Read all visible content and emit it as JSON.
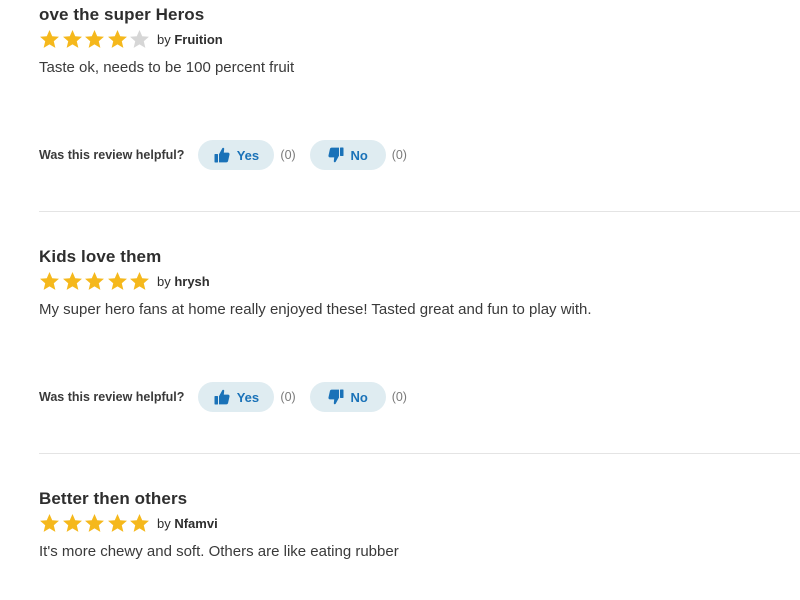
{
  "helpful_prompt": "Was this review helpful?",
  "yes_label": "Yes",
  "no_label": "No",
  "by_prefix": "by",
  "star_color": "#f5b81c",
  "star_empty_color": "#d6d6d6",
  "button_bg": "#dfecf1",
  "button_text_color": "#1a72b8",
  "reviews": [
    {
      "title": "ove the super Heros",
      "rating": 4,
      "max_rating": 5,
      "author": "Fruition",
      "body": "Taste ok, needs to be 100 percent fruit",
      "yes_count": "(0)",
      "no_count": "(0)"
    },
    {
      "title": "Kids love them",
      "rating": 5,
      "max_rating": 5,
      "author": "hrysh",
      "body": "My super hero fans at home really enjoyed these! Tasted great and fun to play with.",
      "yes_count": "(0)",
      "no_count": "(0)"
    },
    {
      "title": "Better then others",
      "rating": 5,
      "max_rating": 5,
      "author": "Nfamvi",
      "body": "It's more chewy and soft. Others are like eating rubber"
    }
  ]
}
